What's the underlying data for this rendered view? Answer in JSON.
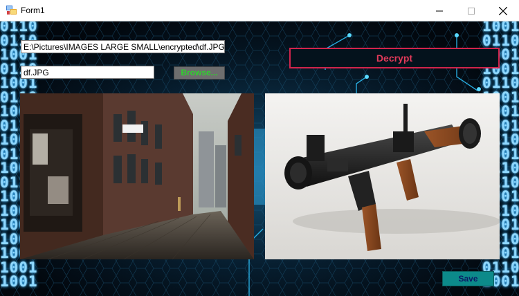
{
  "window": {
    "title": "Form1",
    "minimize_glyph": "—",
    "maximize_glyph": "☐",
    "close_glyph": "✕"
  },
  "background": {
    "left_binary": "0110\n0110\n1001\n0110\n1001\n0110\n1001\n0110\n1001\n0110\n1001\n0110\n1000\n1001\n1001\n1001\n1000\n1001\n1001",
    "right_binary": "1001\n0110\n1001\n1001\n0110\n1001\n1001\n1001\n0110\n1001\n0110\n0110\n1001\n0110\n1001\n0110\n1001\n0110\n1001"
  },
  "form": {
    "path_value": "E:\\Pictures\\IMAGES LARGE SMALL\\encrypted\\df.JPG",
    "filename_value": "df.JPG",
    "browse_label": "Browse...",
    "decrypt_label": "Decrypt",
    "save_label": "Save"
  },
  "images": {
    "left": "street-photo",
    "right": "rocket-launcher-photo"
  },
  "colors": {
    "decrypt_border": "#d2244c",
    "decrypt_text": "#e23a5a",
    "browse_text": "#2fd12f",
    "save_bg": "#0c8a8a",
    "save_text": "#0a1a66",
    "binary_glow": "#8fd8ff"
  }
}
